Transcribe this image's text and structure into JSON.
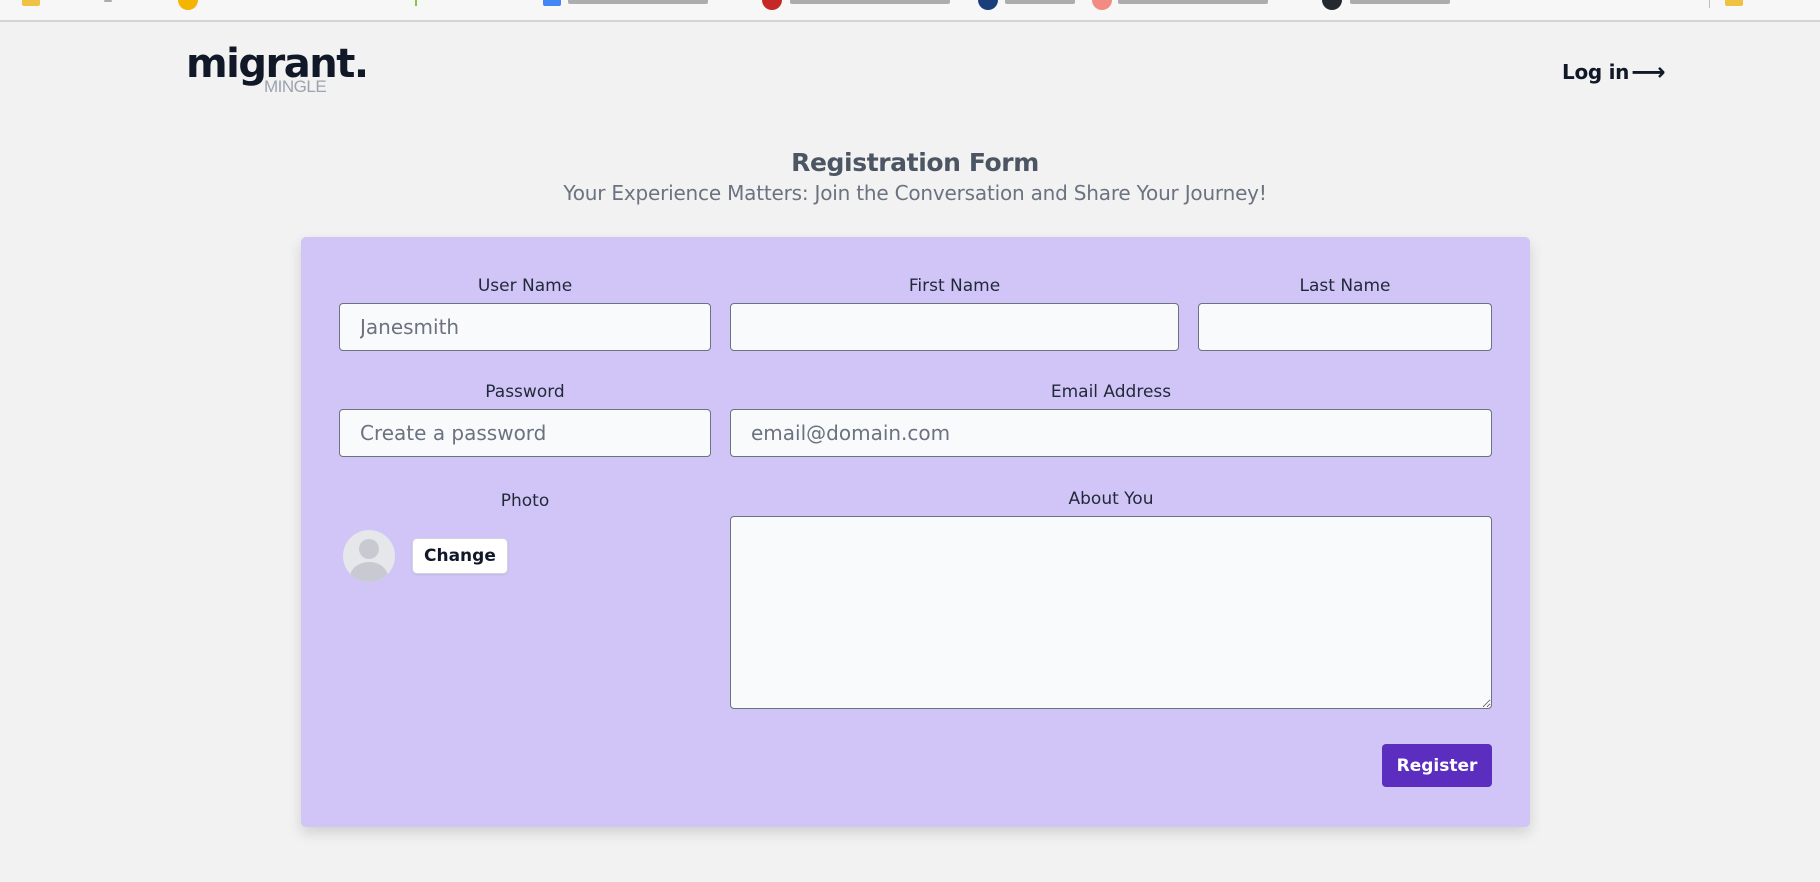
{
  "header": {
    "logo_main": "migrant.",
    "logo_sub": "MINGLE",
    "login_label": "Log in",
    "login_arrow": "⟶"
  },
  "page": {
    "title": "Registration Form",
    "subtitle": "Your Experience Matters: Join the Conversation and Share Your Journey!"
  },
  "form": {
    "username": {
      "label": "User Name",
      "placeholder": "Janesmith",
      "value": ""
    },
    "first_name": {
      "label": "First Name",
      "placeholder": "",
      "value": ""
    },
    "last_name": {
      "label": "Last Name",
      "placeholder": "",
      "value": ""
    },
    "password": {
      "label": "Password",
      "placeholder": "Create a password",
      "value": ""
    },
    "email": {
      "label": "Email Address",
      "placeholder": "email@domain.com",
      "value": ""
    },
    "photo": {
      "label": "Photo",
      "change_label": "Change"
    },
    "about": {
      "label": "About You",
      "value": ""
    },
    "register_label": "Register"
  },
  "colors": {
    "background": "#f2f2f2",
    "card": "#d1c5f7",
    "primary_button": "#5b2ec0",
    "text_dark": "#111827",
    "title": "#4b5563"
  },
  "icons": {
    "avatar": "user-avatar-placeholder-icon",
    "login_arrow": "arrow-right-icon"
  }
}
